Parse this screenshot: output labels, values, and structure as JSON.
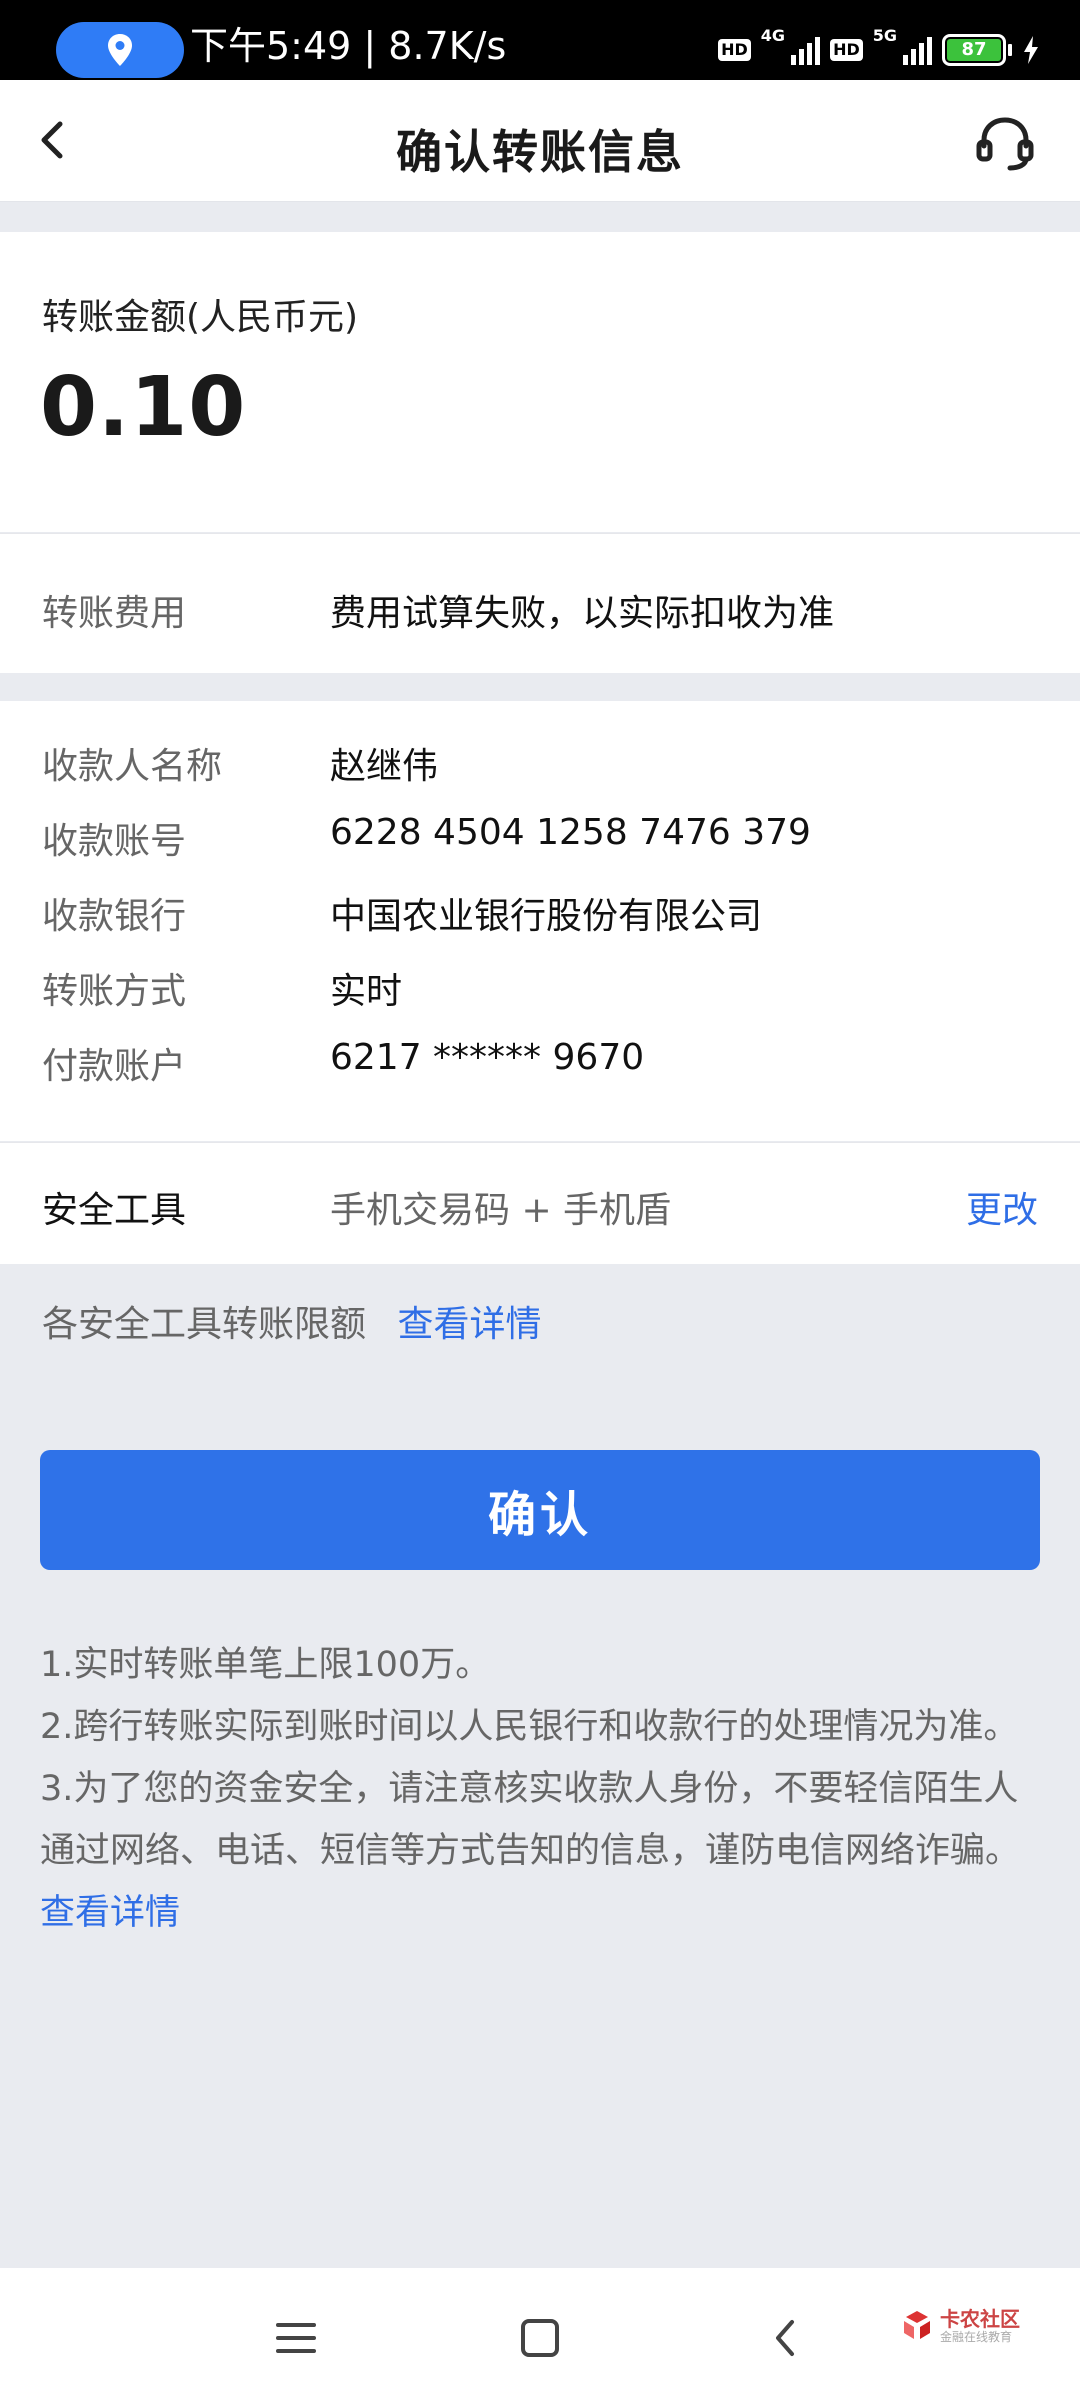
{
  "status_bar": {
    "time_speed": "下午5:49 | 8.7K/s",
    "hd1": "HD",
    "net1": "4G",
    "hd2": "HD",
    "net2": "5G",
    "battery": "87"
  },
  "header": {
    "title": "确认转账信息"
  },
  "amount": {
    "label": "转账金额(人民币元)",
    "value": "0.10"
  },
  "fee": {
    "label": "转账费用",
    "value": "费用试算失败，以实际扣收为准"
  },
  "details": [
    {
      "label": "收款人名称",
      "value": "赵继伟"
    },
    {
      "label": "收款账号",
      "value": "6228 4504 1258 7476 379"
    },
    {
      "label": "收款银行",
      "value": "中国农业银行股份有限公司"
    },
    {
      "label": "转账方式",
      "value": "实时"
    },
    {
      "label": "付款账户",
      "value": "6217 ****** 9670"
    }
  ],
  "security": {
    "label": "安全工具",
    "value": "手机交易码 + 手机盾",
    "change": "更改"
  },
  "limits": {
    "text": "各安全工具转账限额",
    "link": "查看详情"
  },
  "confirm_label": "确认",
  "notes": {
    "line1": "1.实时转账单笔上限100万。",
    "line2": "2.跨行转账实际到账时间以人民银行和收款行的处理情况为准。",
    "line3": "3.为了您的资金安全，请注意核实收款人身份，不要轻信陌生人通过网络、电话、短信等方式告知的信息，谨防电信网络诈骗。",
    "link": "查看详情"
  },
  "watermark": {
    "main": "卡农社区",
    "sub": "金融在线教育"
  },
  "colors": {
    "accent": "#2f72e8",
    "link": "#2f6ee6",
    "background": "#e9ebf0"
  },
  "icons": {
    "location": "location-pin-icon",
    "back": "chevron-left-icon",
    "service": "headset-icon",
    "menu": "menu-icon",
    "home": "home-icon",
    "nav_back": "back-icon"
  }
}
